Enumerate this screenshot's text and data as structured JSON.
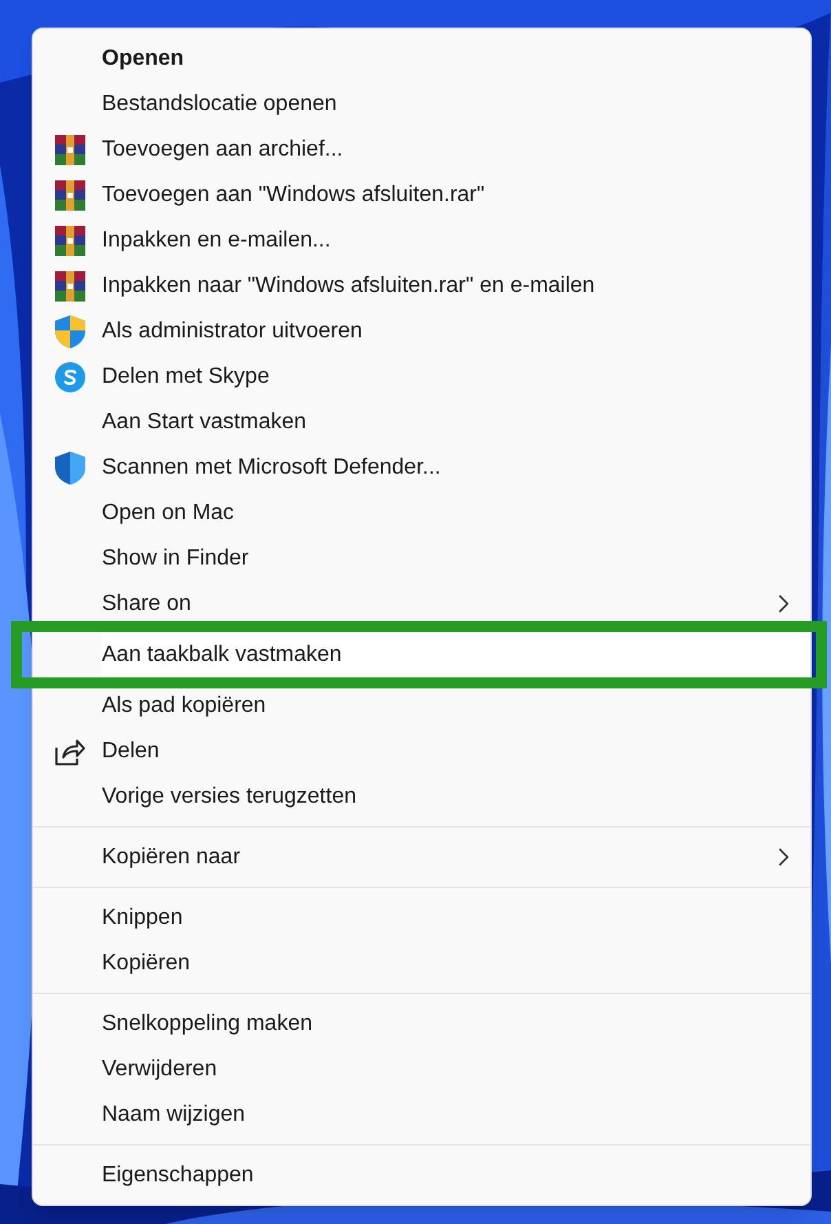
{
  "menu": {
    "groups": [
      {
        "items": [
          {
            "kind": "plain",
            "label": "Openen",
            "bold": true,
            "submenu": false,
            "highlighted": false
          },
          {
            "kind": "plain",
            "label": "Bestandslocatie openen",
            "bold": false,
            "submenu": false,
            "highlighted": false
          },
          {
            "kind": "archive",
            "label": "Toevoegen aan archief...",
            "bold": false,
            "submenu": false,
            "highlighted": false
          },
          {
            "kind": "archive",
            "label": "Toevoegen aan \"Windows afsluiten.rar\"",
            "bold": false,
            "submenu": false,
            "highlighted": false
          },
          {
            "kind": "archive",
            "label": "Inpakken en e-mailen...",
            "bold": false,
            "submenu": false,
            "highlighted": false
          },
          {
            "kind": "archive",
            "label": "Inpakken naar \"Windows afsluiten.rar\" en e-mailen",
            "bold": false,
            "submenu": false,
            "highlighted": false
          },
          {
            "kind": "uac",
            "label": "Als administrator uitvoeren",
            "bold": false,
            "submenu": false,
            "highlighted": false
          },
          {
            "kind": "skype",
            "label": "Delen met Skype",
            "bold": false,
            "submenu": false,
            "highlighted": false
          },
          {
            "kind": "plain",
            "label": "Aan Start vastmaken",
            "bold": false,
            "submenu": false,
            "highlighted": false
          },
          {
            "kind": "defender",
            "label": "Scannen met Microsoft Defender...",
            "bold": false,
            "submenu": false,
            "highlighted": false
          },
          {
            "kind": "plain",
            "label": "Open on Mac",
            "bold": false,
            "submenu": false,
            "highlighted": false
          },
          {
            "kind": "plain",
            "label": "Show in Finder",
            "bold": false,
            "submenu": false,
            "highlighted": false
          },
          {
            "kind": "plain",
            "label": "Share on",
            "bold": false,
            "submenu": true,
            "highlighted": false
          },
          {
            "kind": "plain",
            "label": "Aan taakbalk vastmaken",
            "bold": false,
            "submenu": false,
            "highlighted": true
          },
          {
            "kind": "plain",
            "label": "Als pad kopiëren",
            "bold": false,
            "submenu": false,
            "highlighted": false
          },
          {
            "kind": "share",
            "label": "Delen",
            "bold": false,
            "submenu": false,
            "highlighted": false
          },
          {
            "kind": "plain",
            "label": "Vorige versies terugzetten",
            "bold": false,
            "submenu": false,
            "highlighted": false
          }
        ]
      },
      {
        "items": [
          {
            "kind": "plain",
            "label": "Kopiëren naar",
            "bold": false,
            "submenu": true,
            "highlighted": false
          }
        ]
      },
      {
        "items": [
          {
            "kind": "plain",
            "label": "Knippen",
            "bold": false,
            "submenu": false,
            "highlighted": false
          },
          {
            "kind": "plain",
            "label": "Kopiëren",
            "bold": false,
            "submenu": false,
            "highlighted": false
          }
        ]
      },
      {
        "items": [
          {
            "kind": "plain",
            "label": "Snelkoppeling maken",
            "bold": false,
            "submenu": false,
            "highlighted": false
          },
          {
            "kind": "plain",
            "label": "Verwijderen",
            "bold": false,
            "submenu": false,
            "highlighted": false
          },
          {
            "kind": "plain",
            "label": "Naam wijzigen",
            "bold": false,
            "submenu": false,
            "highlighted": false
          }
        ]
      },
      {
        "items": [
          {
            "kind": "plain",
            "label": "Eigenschappen",
            "bold": false,
            "submenu": false,
            "highlighted": false
          }
        ]
      }
    ]
  }
}
